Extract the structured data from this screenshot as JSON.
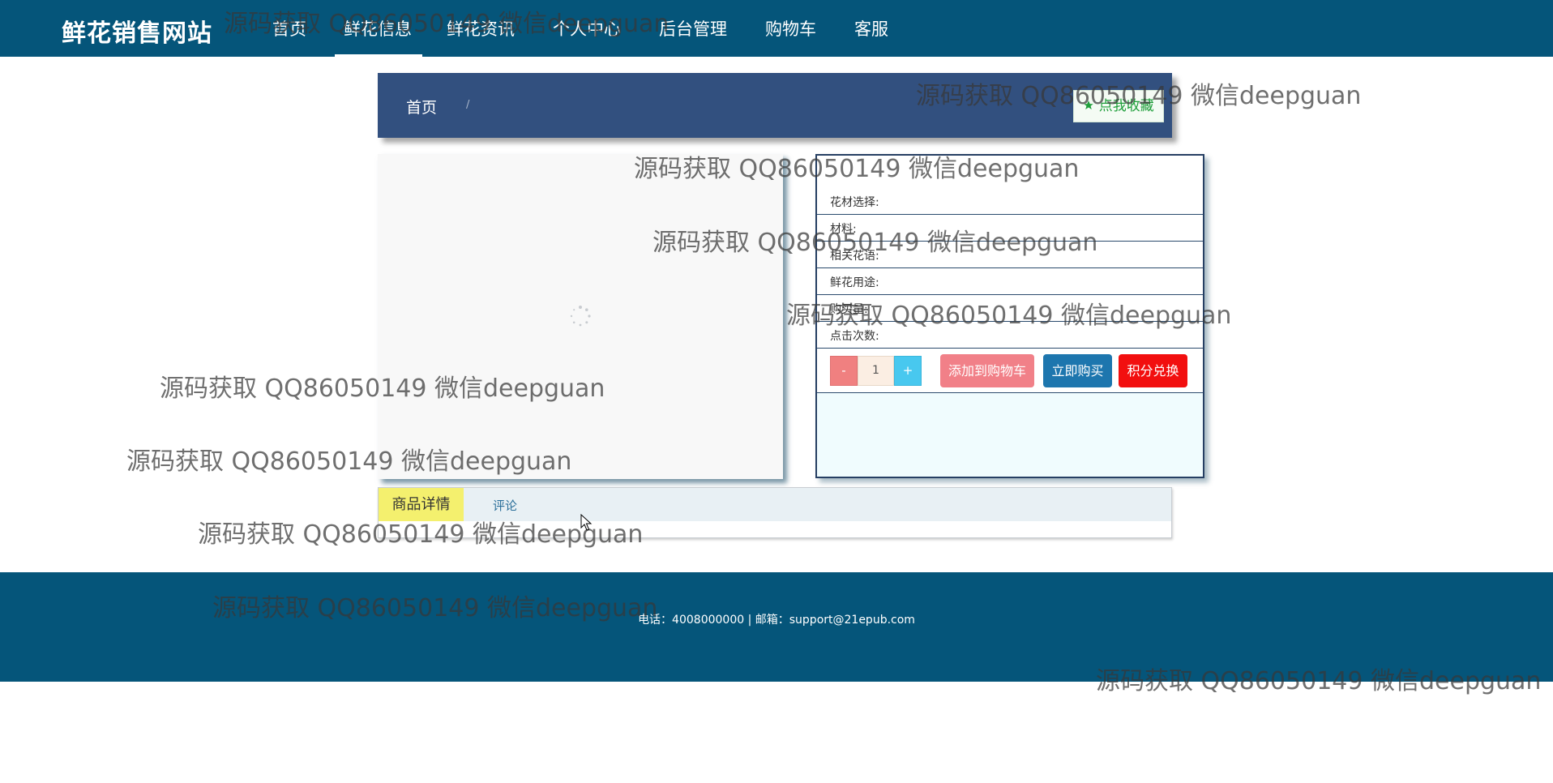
{
  "nav": {
    "brand": "鲜花销售网站",
    "items": [
      "首页",
      "鲜花信息",
      "鲜花资讯",
      "个人中心",
      "后台管理",
      "购物车",
      "客服"
    ]
  },
  "breadcrumb": {
    "home": "首页",
    "separator": "/",
    "favorite_label": "点我收藏"
  },
  "detail": {
    "fields": [
      "花材选择:",
      "材料:",
      "相关花语:",
      "鲜花用途:",
      "购买量:",
      "点击次数:"
    ],
    "quantity": "1",
    "minus_label": "-",
    "plus_label": "+",
    "add_to_cart": "添加到购物车",
    "buy_now": "立即购买",
    "points_exchange": "积分兑换"
  },
  "tabs": {
    "details": "商品详情",
    "reviews": "评论"
  },
  "footer": {
    "contact": "电话：4008000000 | 邮箱：support@21epub.com"
  },
  "watermark": "源码获取 QQ86050149 微信deepguan",
  "colors": {
    "header_bg": "#05557a",
    "breadcrumb_bg": "#32507f",
    "active_tab": "#f4f06e",
    "cart_button": "#f18088",
    "buy_button": "#1d76ae",
    "points_button": "#f20f0f"
  },
  "icons": {
    "favorite": "star-icon",
    "loading": "spinner-icon"
  }
}
